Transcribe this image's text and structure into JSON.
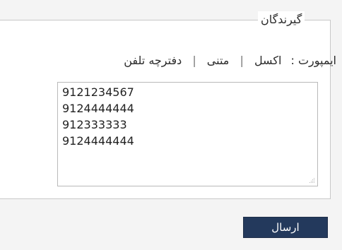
{
  "recipients": {
    "legend": "گیرندگان",
    "import": {
      "label": "ایمپورت :",
      "options": [
        "اکسل",
        "متنی",
        "دفترچه تلفن"
      ],
      "separator": "|"
    },
    "numbers_text": "9121234567\n9124444444\n912333333\n9124444444"
  },
  "actions": {
    "send_label": "ارسال"
  },
  "icons": {
    "resize": "resize-grip-icon"
  },
  "colors": {
    "button_bg": "#23395c",
    "page_bg": "#f4f4f4",
    "panel_bg": "#ffffff",
    "border": "#c8c8c8"
  }
}
